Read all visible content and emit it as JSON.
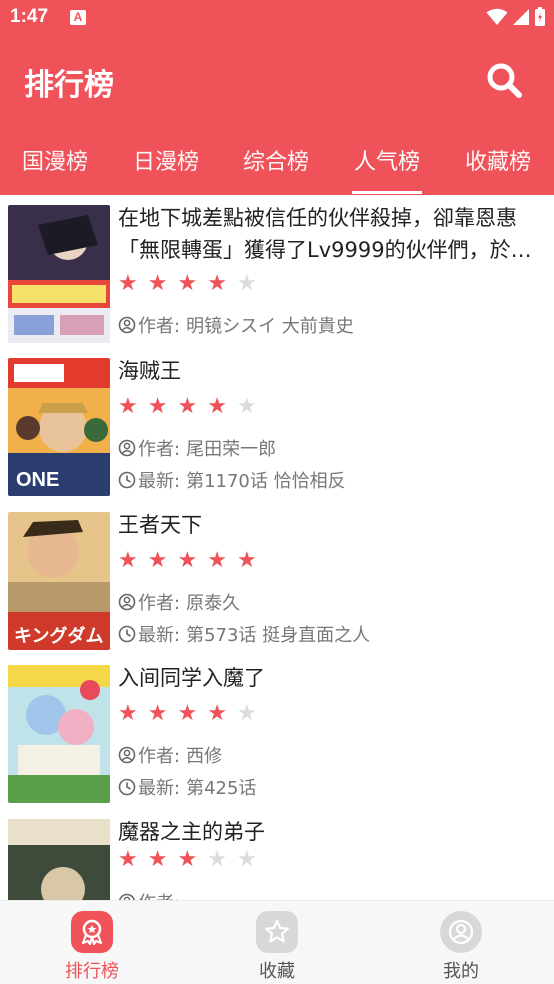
{
  "status": {
    "time": "1:47"
  },
  "header": {
    "title": "排行榜"
  },
  "tabs": [
    {
      "label": "国漫榜"
    },
    {
      "label": "日漫榜"
    },
    {
      "label": "综合榜"
    },
    {
      "label": "人气榜"
    },
    {
      "label": "收藏榜"
    }
  ],
  "active_tab": "人气榜",
  "colors": {
    "accent": "#f0525a",
    "star_off": "#dcdcdc"
  },
  "list": {
    "author_label": "作者:",
    "latest_label": "最新:",
    "items": [
      {
        "title": "在地下城差點被信任的伙伴殺掉，卻靠恩惠「無限轉蛋」獲得了Lv9999的伙伴們，於…",
        "rating": 4,
        "author": "明镜シスイ 大前貴史",
        "latest": ""
      },
      {
        "title": "海贼王",
        "rating": 4,
        "author": "尾田荣一郎",
        "latest": "第1170话 恰恰相反"
      },
      {
        "title": "王者天下",
        "rating": 5,
        "author": "原泰久",
        "latest": "第573话 挺身直面之人"
      },
      {
        "title": "入间同学入魔了",
        "rating": 4,
        "author": "西修",
        "latest": "第425话"
      },
      {
        "title": "魔器之主的弟子",
        "rating": 3,
        "author": "",
        "latest": ""
      }
    ]
  },
  "bottom_nav": [
    {
      "label": "排行榜",
      "icon": "ranking-icon"
    },
    {
      "label": "收藏",
      "icon": "star-icon"
    },
    {
      "label": "我的",
      "icon": "person-icon"
    }
  ]
}
